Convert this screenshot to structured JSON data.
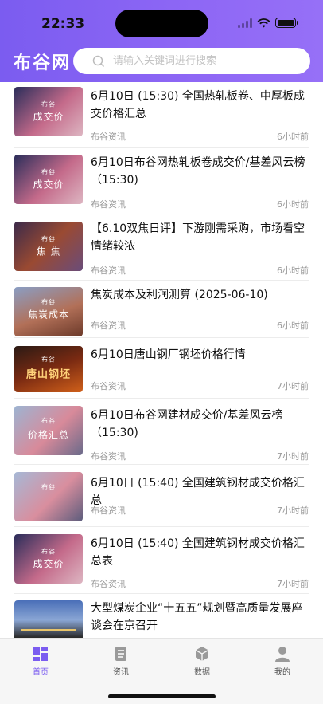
{
  "status_bar": {
    "time": "22:33"
  },
  "header": {
    "logo": "布谷网",
    "search_placeholder": "请输入关键词进行搜索"
  },
  "articles": [
    {
      "title": "6月10日 (15:30) 全国热轧板卷、中厚板成交价格汇总",
      "source": "布谷资讯",
      "time": "6小时前",
      "thumb": "成交价",
      "thumb_icon": "handshake-icon"
    },
    {
      "title": "6月10日布谷网热轧板卷成交价/基差风云榜（15:30)",
      "source": "布谷资讯",
      "time": "6小时前",
      "thumb": "成交价",
      "thumb_icon": "handshake-icon"
    },
    {
      "title": "【6.10双焦日评】下游刚需采购，市场看空情绪较浓",
      "source": "布谷资讯",
      "time": "6小时前",
      "thumb": "焦 焦",
      "thumb_icon": "coke-furnace-icon"
    },
    {
      "title": "焦炭成本及利润测算 (2025-06-10)",
      "source": "布谷资讯",
      "time": "6小时前",
      "thumb": "焦炭成本",
      "thumb_icon": "coke-plant-icon"
    },
    {
      "title": "6月10日唐山钢厂钢坯价格行情",
      "source": "布谷资讯",
      "time": "7小时前",
      "thumb": "唐山钢坯",
      "thumb_icon": "steel-billet-icon"
    },
    {
      "title": "6月10日布谷网建材成交价/基差风云榜（15:30)",
      "source": "布谷资讯",
      "time": "7小时前",
      "thumb": "价格汇总",
      "thumb_icon": "rebar-icon"
    },
    {
      "title": "6月10日 (15:40) 全国建筑钢材成交价格汇总",
      "source": "布谷资讯",
      "time": "7小时前",
      "thumb": "",
      "thumb_icon": "rebar-icon"
    },
    {
      "title": "6月10日 (15:40) 全国建筑钢材成交价格汇总表",
      "source": "布谷资讯",
      "time": "7小时前",
      "thumb": "成交价",
      "thumb_icon": "handshake-icon"
    },
    {
      "title": "大型煤炭企业“十五五”规划暨高质量发展座谈会在京召开",
      "source": "",
      "time": "",
      "thumb": "",
      "thumb_icon": "coal-mine-icon"
    }
  ],
  "thumb_small_label": "布谷",
  "tabbar": {
    "tabs": [
      {
        "label": "首页",
        "icon": "home-grid-icon",
        "active": true
      },
      {
        "label": "资讯",
        "icon": "news-doc-icon",
        "active": false
      },
      {
        "label": "数据",
        "icon": "data-cube-icon",
        "active": false
      },
      {
        "label": "我的",
        "icon": "person-icon",
        "active": false
      }
    ]
  },
  "colors": {
    "brand": "#7b5cf0",
    "text": "#111111",
    "meta": "#9a9a9a",
    "tab_inactive": "#555555"
  }
}
